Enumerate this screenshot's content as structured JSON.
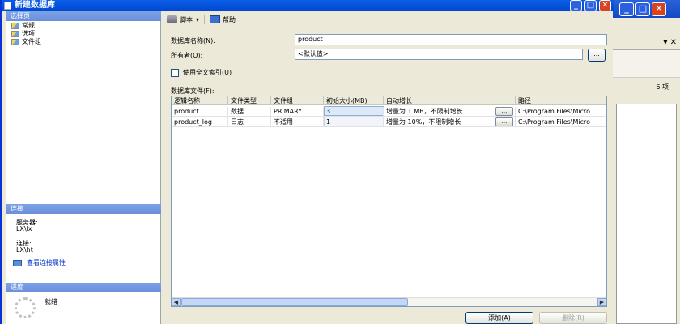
{
  "window": {
    "title": "新建数据库"
  },
  "left_pane": {
    "select_page_header": "选择页",
    "pages": [
      "常规",
      "选项",
      "文件组"
    ],
    "connection_header": "连接",
    "server_label": "服务器:",
    "server_value": "LX\\lx",
    "connection_label": "连接:",
    "connection_value": "LX\\ht",
    "view_connection_link": "查看连接属性",
    "progress_header": "进度",
    "progress_status": "就绪"
  },
  "toolbar": {
    "script_label": "脚本",
    "script_arrow": "▾",
    "help_label": "帮助"
  },
  "form": {
    "db_name_label": "数据库名称(N):",
    "db_name_value": "product",
    "owner_label": "所有者(O):",
    "owner_value": "<默认值>",
    "browse_label": "...",
    "fulltext_label": "使用全文索引(U)",
    "db_files_label": "数据库文件(F):"
  },
  "files_table": {
    "columns": [
      "逻辑名称",
      "文件类型",
      "文件组",
      "初始大小(MB)",
      "自动增长",
      "路径"
    ],
    "rows": [
      {
        "name": "product",
        "type": "数据",
        "filegroup": "PRIMARY",
        "size": "3",
        "growth": "增量为 1 MB，不限制增长",
        "path": "C:\\Program Files\\Micro"
      },
      {
        "name": "product_log",
        "type": "日志",
        "filegroup": "不适用",
        "size": "1",
        "growth": "增量为 10%，不限制增长",
        "path": "C:\\Program Files\\Micro"
      }
    ],
    "cell_button_label": "..."
  },
  "buttons": {
    "add_label": "添加(A)",
    "remove_label": "删除(R)"
  },
  "background_window": {
    "count_text": "6 项",
    "panel_close": "▾ ✕"
  }
}
